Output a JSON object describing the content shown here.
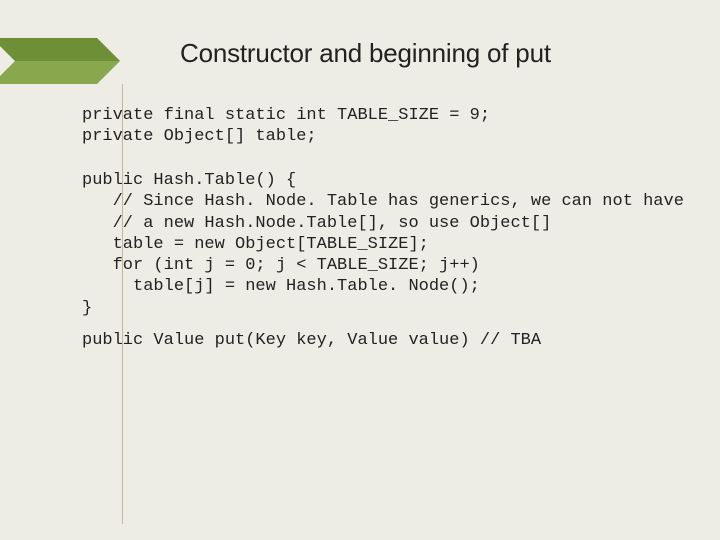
{
  "title": "Constructor and beginning of put",
  "code": {
    "decl1": "private final static int TABLE_SIZE = 9;",
    "decl2": "private Object[] table;",
    "ctor_open": "public Hash.Table() {",
    "ctor_c1": "   // Since Hash. Node. Table has generics, we can not have",
    "ctor_c2": "   // a new Hash.Node.Table[], so use Object[]",
    "ctor_l1": "   table = new Object[TABLE_SIZE];",
    "ctor_l2": "   for (int j = 0; j < TABLE_SIZE; j++)",
    "ctor_l3": "     table[j] = new Hash.Table. Node();",
    "ctor_close": "}",
    "put_sig": "public Value put(Key key, Value value) // TBA"
  },
  "accent_color": "#7a9b3f",
  "accent_dark": "#4f6b20"
}
